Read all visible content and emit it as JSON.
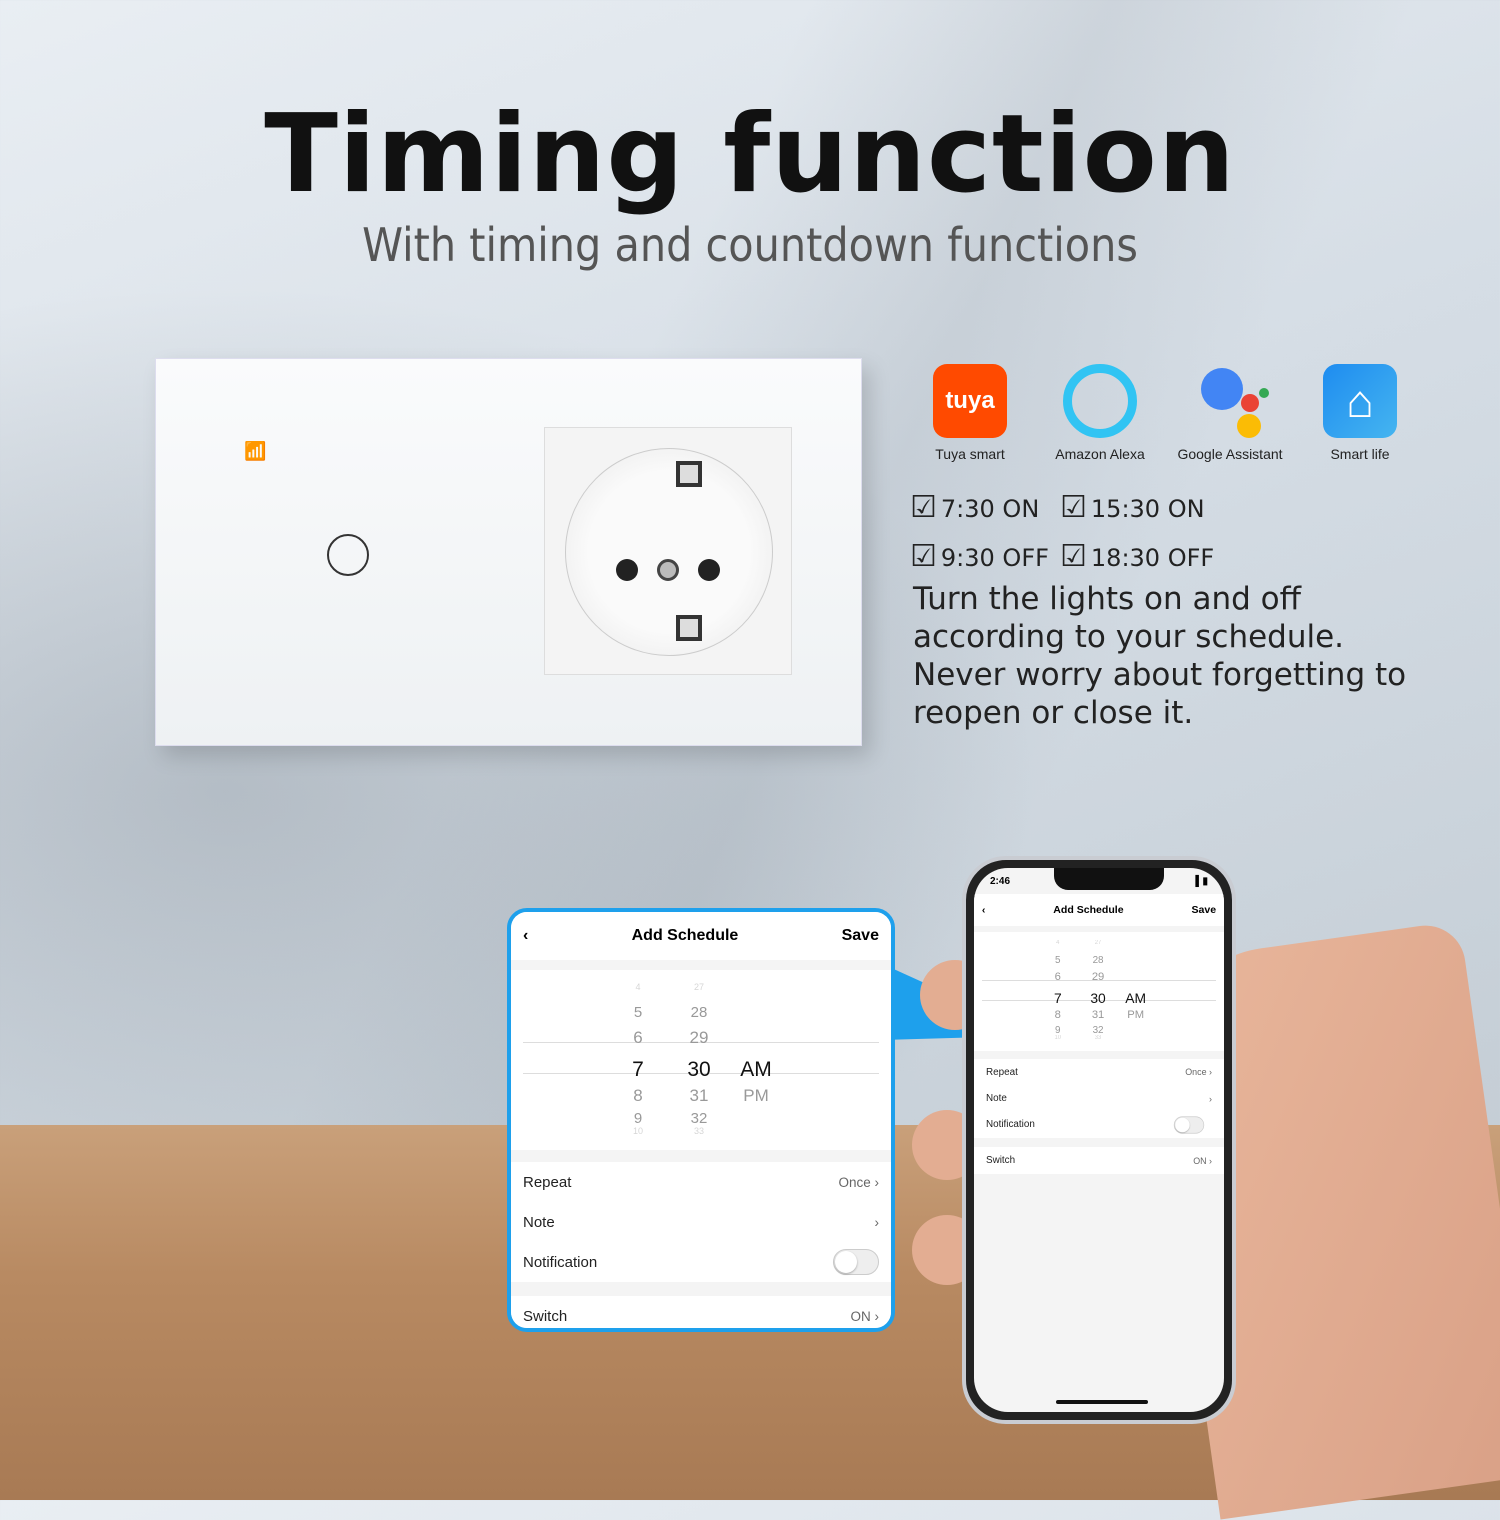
{
  "title": "Timing function",
  "subtitle": "With timing and countdown functions",
  "apps": [
    {
      "label": "Tuya smart",
      "icon": "tuya-icon",
      "logo_text": "tuya",
      "color": "#ff4a00"
    },
    {
      "label": "Amazon Alexa",
      "icon": "alexa-icon",
      "color": "#31c4f3"
    },
    {
      "label": "Google Assistant",
      "icon": "google-assistant-icon"
    },
    {
      "label": "Smart life",
      "icon": "smart-life-icon",
      "color": "#1e8cf0"
    }
  ],
  "schedule_items": [
    "7:30 ON",
    "15:30 ON",
    "9:30 OFF",
    "18:30 OFF"
  ],
  "description": [
    "Turn the lights on and off according to your schedule.",
    "Never worry about forgetting to reopen or close it."
  ],
  "accent": "#1ea0ec",
  "app_screen": {
    "status_time": "2:46",
    "title": "Add Schedule",
    "save": "Save",
    "hours": [
      "4",
      "5",
      "6",
      "7",
      "8",
      "9",
      "10"
    ],
    "minutes": [
      "27",
      "28",
      "29",
      "30",
      "31",
      "32",
      "33"
    ],
    "ampm": [
      "AM",
      "PM"
    ],
    "selected_index": 3,
    "repeat_label": "Repeat",
    "repeat_value": "Once",
    "note_label": "Note",
    "notification_label": "Notification",
    "notification_on": false,
    "switch_label": "Switch",
    "switch_value": "ON"
  }
}
